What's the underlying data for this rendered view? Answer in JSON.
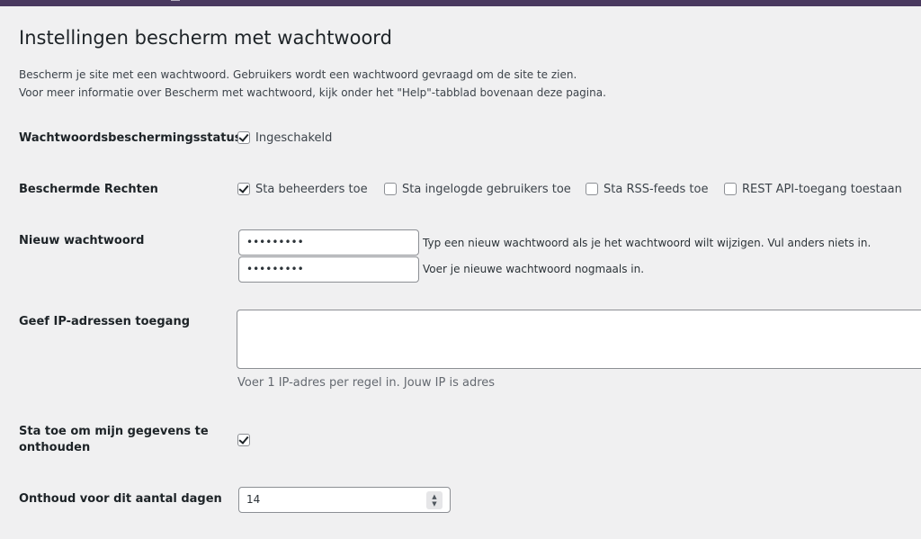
{
  "page": {
    "title": "Instellingen bescherm met wachtwoord",
    "intro_line1": "Bescherm je site met een wachtwoord. Gebruikers wordt een wachtwoord gevraagd om de site te zien.",
    "intro_line2": "Voor meer informatie over Bescherm met wachtwoord, kijk onder het \"Help\"-tabblad bovenaan deze pagina."
  },
  "status": {
    "label": "Wachtwoordsbeschermingsstatus",
    "option": {
      "label": "Ingeschakeld",
      "checked": true
    }
  },
  "permissions": {
    "label": "Beschermde Rechten",
    "options": [
      {
        "label": "Sta beheerders toe",
        "checked": true
      },
      {
        "label": "Sta ingelogde gebruikers toe",
        "checked": false
      },
      {
        "label": "Sta RSS-feeds toe",
        "checked": false
      },
      {
        "label": "REST API-toegang toestaan",
        "checked": false
      }
    ]
  },
  "new_password": {
    "label": "Nieuw wachtwoord",
    "value1": "•••••••••",
    "desc1": "Typ een nieuw wachtwoord als je het wachtwoord wilt wijzigen. Vul anders niets in.",
    "value2": "•••••••••",
    "desc2": "Voer je nieuwe wachtwoord nogmaals in."
  },
  "ip_access": {
    "label": "Geef IP-adressen toegang",
    "value": "",
    "desc": "Voer 1 IP-adres per regel in. Jouw IP is adres"
  },
  "remember": {
    "label_line1": "Sta toe om mijn gegevens te",
    "label_line2": "onthouden",
    "checked": true
  },
  "remember_days": {
    "label": "Onthoud voor dit aantal dagen",
    "value": "14"
  }
}
